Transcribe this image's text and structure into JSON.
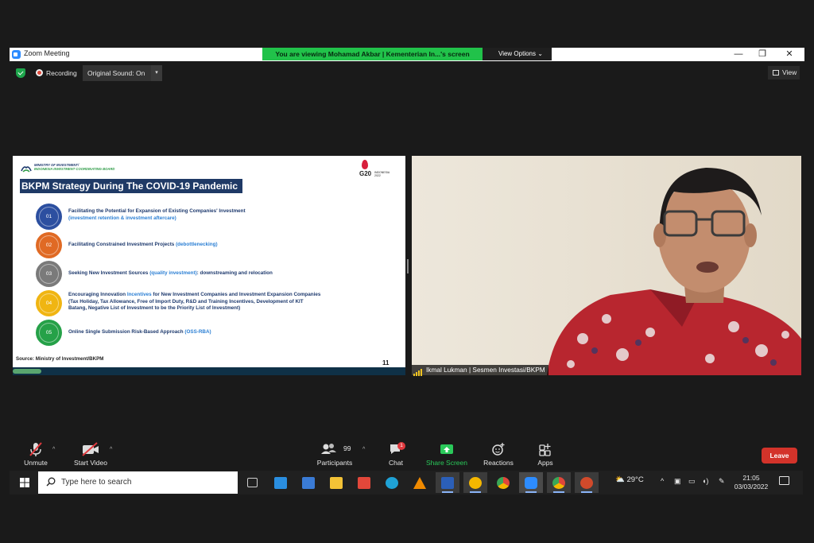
{
  "window": {
    "title": "Zoom Meeting",
    "viewing_banner": "You are viewing Mohamad Akbar | Kementerian In...'s screen",
    "view_options": "View Options",
    "minimize": "—",
    "restore": "❐",
    "close": "✕"
  },
  "status": {
    "recording": "Recording",
    "original_sound": "Original Sound: On",
    "view": "View"
  },
  "slide": {
    "ministry_line1": "MINISTRY OF INVESTMENT/",
    "ministry_line2": "INDONESIA INVESTMENT COORDINATING BOARD",
    "g20_text": "G20",
    "g20_sub1": "INDONESIA",
    "g20_sub2": "2022",
    "title": "BKPM Strategy During The COVID-19 Pandemic",
    "items": [
      {
        "num": "01",
        "color": "#2c4fa0",
        "line1": "Facilitating the Potential for Expansion of Existing Companies' Investment",
        "line2": "(investment retention & investment aftercare)"
      },
      {
        "num": "02",
        "color": "#e06a24",
        "line1a": "Facilitating Constrained Investment Projects ",
        "line1b": "(debottlenecking)"
      },
      {
        "num": "03",
        "color": "#7a7a7a",
        "line1a": "Seeking New Investment Sources ",
        "line1b": "(quality investment)",
        "line1c": ": downstreaming and relocation"
      },
      {
        "num": "04",
        "color": "#f0b512",
        "line1a": "Encouraging Innovation ",
        "line1b": "Incentives",
        "line1c": " for New Investment Companies and Investment Expansion Companies",
        "line2": "(Tax Holiday, Tax Allowance, Free of Import Duty, R&D and Training Incentives, Development of KIT",
        "line3": "Batang, Negative List of Investment to be the Priority List of Investment)"
      },
      {
        "num": "05",
        "color": "#25a148",
        "line1a": "Online Single Submission Risk-Based Approach ",
        "line1b": "(OSS-RBA)"
      }
    ],
    "source": "Source: Ministry of Investment/BKPM",
    "page": "11"
  },
  "participant": {
    "name_label": "Ikmal Lukman | Sesmen Investasi/BKPM"
  },
  "controls": {
    "unmute": "Unmute",
    "start_video": "Start Video",
    "participants": "Participants",
    "participants_count": "99",
    "chat": "Chat",
    "chat_badge": "1",
    "share_screen": "Share Screen",
    "reactions": "Reactions",
    "apps": "Apps",
    "leave": "Leave"
  },
  "taskbar": {
    "search_placeholder": "Type here to search",
    "temperature": "29°C",
    "time": "21:05",
    "date": "03/03/2022",
    "apps": [
      {
        "name": "task-view-icon",
        "color": "#cfcfcf"
      },
      {
        "name": "mail-icon",
        "color": "#2a8ee0"
      },
      {
        "name": "store-icon",
        "color": "#3a7bd5"
      },
      {
        "name": "file-explorer-icon",
        "color": "#f3c236"
      },
      {
        "name": "office-icon",
        "color": "#e2473a"
      },
      {
        "name": "edge-icon",
        "color": "#1fa2d6"
      },
      {
        "name": "vlc-icon",
        "color": "#f08a00"
      },
      {
        "name": "word-icon",
        "color": "#2b5fb8"
      },
      {
        "name": "chrome-canary-icon",
        "color": "#f5b700"
      },
      {
        "name": "chrome-icon",
        "color": "#e0463a"
      },
      {
        "name": "zoom-icon",
        "color": "#2d8cff"
      },
      {
        "name": "chrome-profile-icon",
        "color": "#4c9a53"
      },
      {
        "name": "powerpoint-icon",
        "color": "#d14a2b"
      }
    ]
  }
}
